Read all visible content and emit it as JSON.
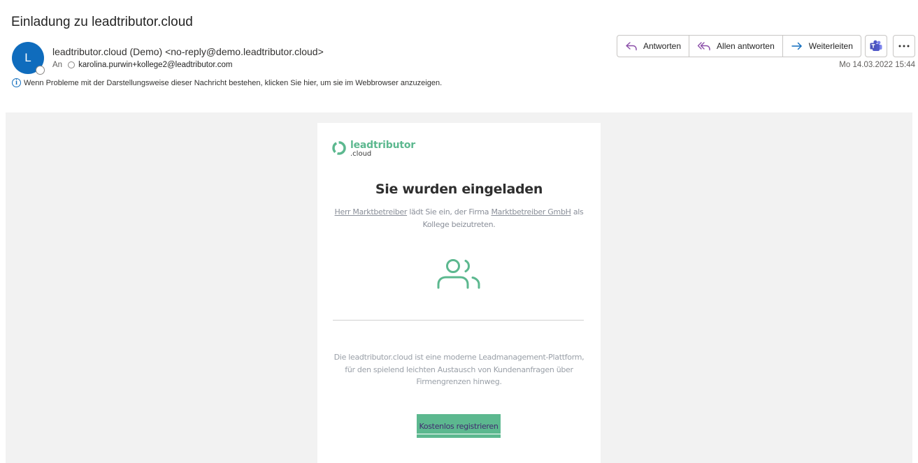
{
  "message": {
    "subject": "Einladung zu leadtributor.cloud",
    "avatar_initial": "L",
    "sender": "leadtributor.cloud (Demo) <no-reply@demo.leadtributor.cloud>",
    "to_label": "An",
    "recipient": "karolina.purwin+kollege2@leadtributor.com",
    "info_notice": "Wenn Probleme mit der Darstellungsweise dieser Nachricht bestehen, klicken Sie hier, um sie im Webbrowser anzuzeigen.",
    "date": "Mo 14.03.2022 15:44"
  },
  "toolbar": {
    "reply": "Antworten",
    "reply_all": "Allen antworten",
    "forward": "Weiterleiten",
    "icons": [
      "reply-icon",
      "reply-all-icon",
      "forward-icon",
      "teams-icon",
      "more-icon"
    ]
  },
  "email_body": {
    "logo_name": "leadtributor",
    "logo_sub": ".cloud",
    "headline": "Sie wurden eingeladen",
    "inviter": "Herr Marktbetreiber",
    "intro_mid": "lädt Sie ein, der Firma",
    "company": "Marktbetreiber GmbH",
    "intro_end": "als Kollege beizutreten.",
    "description": "Die leadtributor.cloud ist eine moderne Leadmanagement-Plattform, für den spielend leichten Austausch von Kundenanfragen über Firmengrenzen hinweg.",
    "cta_label": "Kostenlos registrieren"
  },
  "colors": {
    "brand_green": "#5cb88f",
    "outlook_blue": "#0f6cbd",
    "cta_text": "#3f2a6f"
  }
}
